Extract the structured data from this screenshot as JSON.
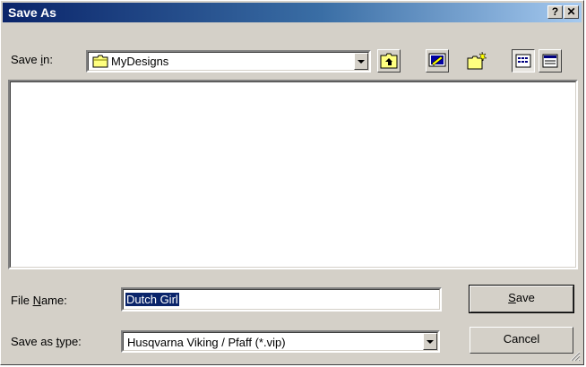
{
  "window": {
    "title": "Save As"
  },
  "title_buttons": {
    "help": "?",
    "close": "✕"
  },
  "save_in": {
    "label_pre": "Save ",
    "label_accel": "i",
    "label_post": "n:",
    "value": "MyDesigns"
  },
  "toolbar": {
    "icons": [
      "up-one-level-icon",
      "desktop-icon",
      "new-folder-icon",
      "list-view-icon",
      "details-view-icon"
    ]
  },
  "file_name": {
    "label_accel": "N",
    "label_pre": "File ",
    "label_post": "ame:",
    "value": "Dutch Girl"
  },
  "save_as_type": {
    "label_pre": "Save as ",
    "label_accel": "t",
    "label_post": "ype:",
    "value": "Husqvarna Viking / Pfaff (*.vip)"
  },
  "buttons": {
    "save_accel": "S",
    "save_rest": "ave",
    "cancel": "Cancel"
  },
  "colors": {
    "titlebar_start": "#0a246a",
    "face": "#d4d0c8",
    "selection": "#0a246a"
  }
}
